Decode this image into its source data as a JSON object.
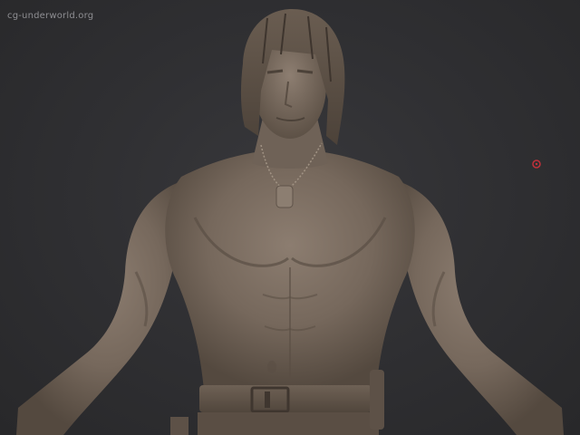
{
  "viewport": {
    "watermark_text": "cg-underworld.org",
    "background_color": "#2b2b2d",
    "model_subject": "male-bust-sculpt",
    "model_material_color": "#7d6e62",
    "cursor_color": "#c0303a"
  }
}
